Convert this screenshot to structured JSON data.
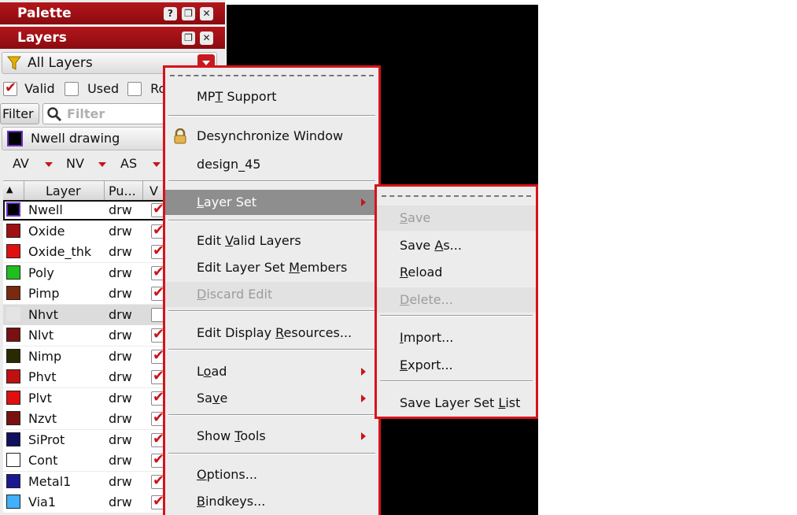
{
  "palette": {
    "title": "Palette",
    "help_glyph": "?",
    "float_glyph": "❐",
    "close_glyph": "✕"
  },
  "layers": {
    "title": "Layers",
    "float_glyph": "❐",
    "close_glyph": "✕"
  },
  "layerset_filter": {
    "value": "All Layers"
  },
  "checkboxes": [
    {
      "label": "Valid",
      "checked": true
    },
    {
      "label": "Used",
      "checked": false
    },
    {
      "label": "Ro",
      "checked": false
    }
  ],
  "filter": {
    "button_label": "Filter",
    "placeholder": "Filter"
  },
  "current_layer": {
    "label": "Nwell drawing"
  },
  "visibility": {
    "av": "AV",
    "nv": "NV",
    "as": "AS"
  },
  "table": {
    "columns": [
      "Layer",
      "Pu...",
      "V"
    ],
    "rows": [
      {
        "name": "Nwell",
        "purpose": "drw",
        "visible": true,
        "swatch": "#000000",
        "border": "#6a2fbf",
        "selected": true
      },
      {
        "name": "Oxide",
        "purpose": "drw",
        "visible": true,
        "swatch": "#a01010",
        "border": "#222222"
      },
      {
        "name": "Oxide_thk",
        "purpose": "drw",
        "visible": true,
        "swatch": "#e01010",
        "border": "#222222"
      },
      {
        "name": "Poly",
        "purpose": "drw",
        "visible": true,
        "swatch": "#1fbf1f",
        "border": "#222222"
      },
      {
        "name": "Pimp",
        "purpose": "drw",
        "visible": true,
        "swatch": "#7a2a10",
        "border": "#222222"
      },
      {
        "name": "Nhvt",
        "purpose": "drw",
        "visible": false,
        "swatch": "#e4e4e4",
        "border": "#e4e4e4",
        "highlight": true
      },
      {
        "name": "Nlvt",
        "purpose": "drw",
        "visible": true,
        "swatch": "#7a1010",
        "border": "#222222"
      },
      {
        "name": "Nimp",
        "purpose": "drw",
        "visible": true,
        "swatch": "#2a2a00",
        "border": "#222222"
      },
      {
        "name": "Phvt",
        "purpose": "drw",
        "visible": true,
        "swatch": "#c01010",
        "border": "#222222"
      },
      {
        "name": "Plvt",
        "purpose": "drw",
        "visible": true,
        "swatch": "#e01010",
        "border": "#222222"
      },
      {
        "name": "Nzvt",
        "purpose": "drw",
        "visible": true,
        "swatch": "#7a1010",
        "border": "#222222"
      },
      {
        "name": "SiProt",
        "purpose": "drw",
        "visible": true,
        "swatch": "#101060",
        "border": "#222222"
      },
      {
        "name": "Cont",
        "purpose": "drw",
        "visible": true,
        "swatch": "#ffffff",
        "border": "#222222"
      },
      {
        "name": "Metal1",
        "purpose": "drw",
        "visible": true,
        "swatch": "#1a1a90",
        "border": "#222222"
      },
      {
        "name": "Via1",
        "purpose": "drw",
        "visible": true,
        "swatch": "#40b0ff",
        "border": "#222222"
      }
    ]
  },
  "context_menu": {
    "items": [
      {
        "pre": "MP",
        "u": "T",
        "post": " Support"
      },
      {
        "pre": "Desynchronize Window",
        "u": "",
        "post": "",
        "icon": "lock-icon"
      },
      {
        "pre": "design_45",
        "u": "",
        "post": ""
      },
      {
        "pre": "",
        "u": "L",
        "post": "ayer Set"
      },
      {
        "pre": "Edit ",
        "u": "V",
        "post": "alid Layers"
      },
      {
        "pre": "Edit Layer Set ",
        "u": "M",
        "post": "embers"
      },
      {
        "pre": "",
        "u": "D",
        "post": "iscard Edit"
      },
      {
        "pre": "Edit Display ",
        "u": "R",
        "post": "esources..."
      },
      {
        "pre": "L",
        "u": "o",
        "post": "ad"
      },
      {
        "pre": "Sa",
        "u": "v",
        "post": "e"
      },
      {
        "pre": "Show ",
        "u": "T",
        "post": "ools"
      },
      {
        "pre": "",
        "u": "O",
        "post": "ptions..."
      },
      {
        "pre": "",
        "u": "B",
        "post": "indkeys..."
      }
    ]
  },
  "submenu": {
    "items": [
      {
        "pre": "",
        "u": "S",
        "post": "ave"
      },
      {
        "pre": "Save ",
        "u": "A",
        "post": "s..."
      },
      {
        "pre": "",
        "u": "R",
        "post": "eload"
      },
      {
        "pre": "",
        "u": "D",
        "post": "elete..."
      },
      {
        "pre": "",
        "u": "I",
        "post": "mport..."
      },
      {
        "pre": "",
        "u": "E",
        "post": "xport..."
      },
      {
        "pre": "Save Layer Set ",
        "u": "L",
        "post": "ist"
      }
    ]
  },
  "colors": {
    "accent": "#c8141a",
    "titlebar": "#a51218",
    "menu_highlight": "#8e8e8e"
  }
}
